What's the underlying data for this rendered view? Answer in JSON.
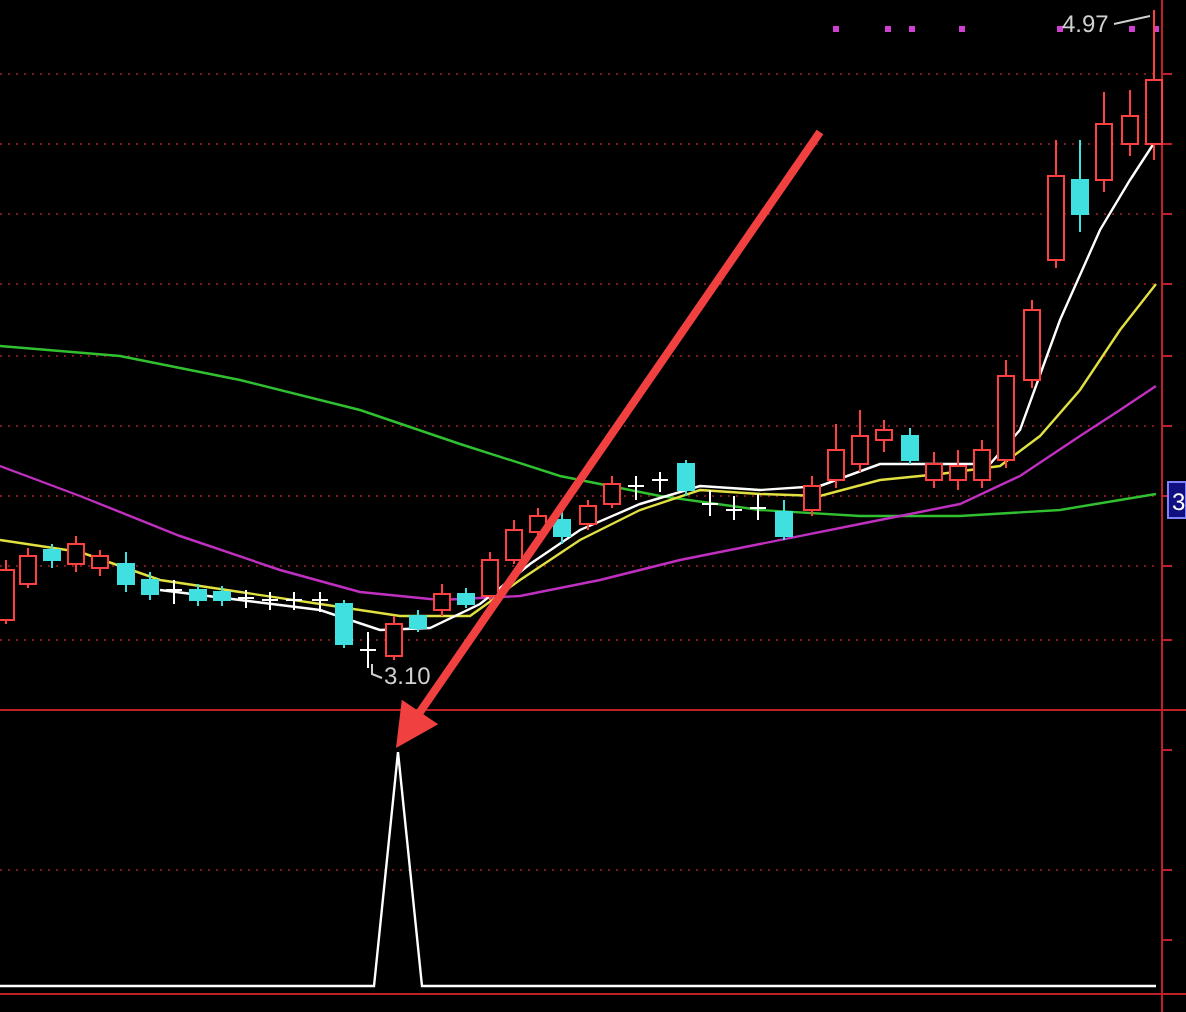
{
  "price_panel": {
    "high_label": "4.97",
    "low_label": "3.10",
    "axis_label": "3"
  }
}
